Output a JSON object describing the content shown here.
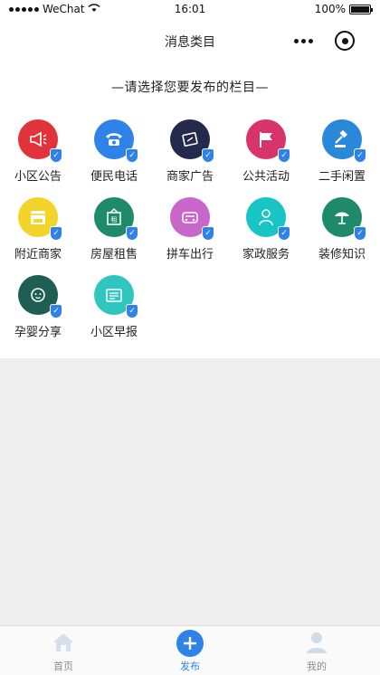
{
  "status_bar": {
    "carrier": "WeChat",
    "time": "16:01",
    "battery": "100%",
    "battery_level": 1.0
  },
  "nav": {
    "title": "消息类目"
  },
  "prompt": "—请选择您要发布的栏目—",
  "categories": [
    {
      "label": "小区公告",
      "color": "#e0333b",
      "icon": "megaphone-icon"
    },
    {
      "label": "便民电话",
      "color": "#2f83e8",
      "icon": "telephone-icon"
    },
    {
      "label": "商家广告",
      "color": "#232a4d",
      "icon": "coupon-icon"
    },
    {
      "label": "公共活动",
      "color": "#d8336a",
      "icon": "flag-icon"
    },
    {
      "label": "二手闲置",
      "color": "#2a88d8",
      "icon": "gavel-icon"
    },
    {
      "label": "附近商家",
      "color": "#f2d42a",
      "icon": "store-icon"
    },
    {
      "label": "房屋租售",
      "color": "#1f8a6a",
      "icon": "rent-sign-icon"
    },
    {
      "label": "拼车出行",
      "color": "#c966c9",
      "icon": "car-icon"
    },
    {
      "label": "家政服务",
      "color": "#17c5c5",
      "icon": "housekeeper-icon"
    },
    {
      "label": "装修知识",
      "color": "#1f8a6a",
      "icon": "tools-icon"
    },
    {
      "label": "孕婴分享",
      "color": "#1f5e52",
      "icon": "baby-icon"
    },
    {
      "label": "小区早报",
      "color": "#2fc6c0",
      "icon": "newspaper-icon"
    }
  ],
  "tabs": [
    {
      "label": "首页",
      "icon": "home-icon",
      "active": false
    },
    {
      "label": "发布",
      "icon": "plus-circle-icon",
      "active": true
    },
    {
      "label": "我的",
      "icon": "user-icon",
      "active": false
    }
  ],
  "colors": {
    "accent": "#2f83e8",
    "page_bg": "#eeeeef"
  }
}
